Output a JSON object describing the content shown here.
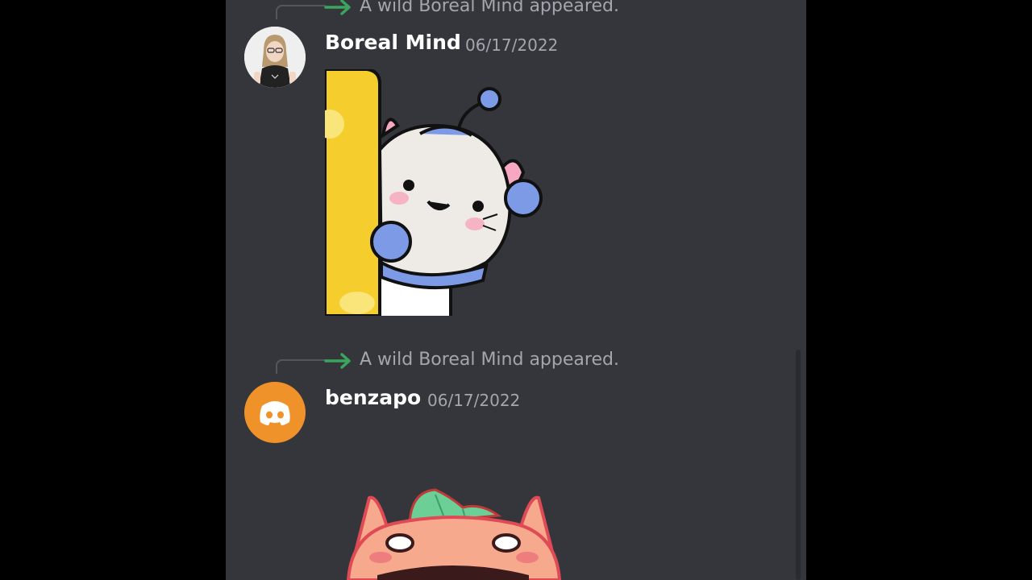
{
  "messages": [
    {
      "system_text": "A wild Boreal Mind appeared.",
      "username": "Boreal Mind",
      "timestamp": "06/17/2022",
      "avatar": "user-photo-avatar",
      "sticker": "peeking-hamster-sticker"
    },
    {
      "system_text": "A wild Boreal Mind appeared.",
      "username": "benzapo",
      "timestamp": "06/17/2022",
      "avatar": "discord-default-avatar",
      "avatar_color": "#f0922a",
      "sticker": "peach-cat-sticker"
    }
  ],
  "colors": {
    "background": "#35363c",
    "join_arrow": "#3ba55d",
    "muted_text": "#a3a6ad"
  }
}
